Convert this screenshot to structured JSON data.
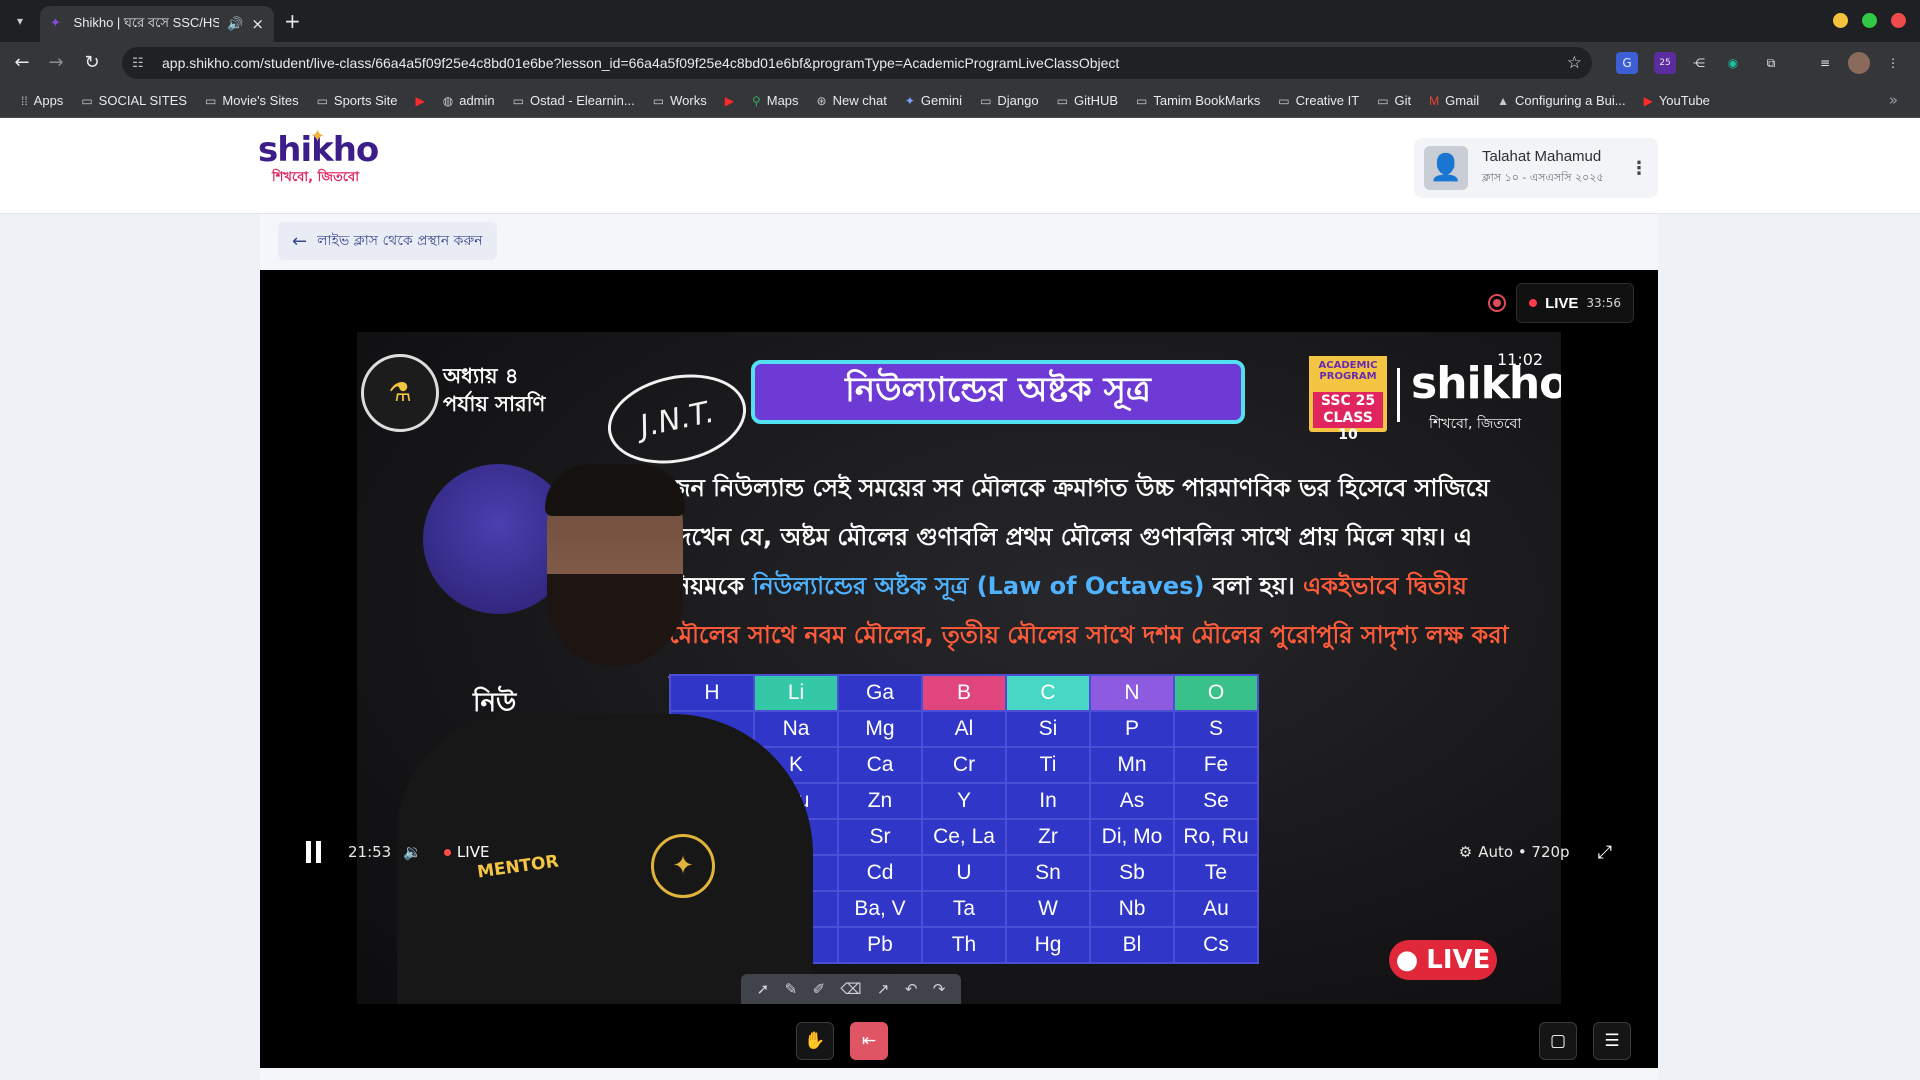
{
  "browser": {
    "tab": {
      "title": "Shikho | ঘরে বসে SSC/HSC"
    },
    "url": "app.shikho.com/student/live-class/66a4a5f09f25e4c8bd01e6be?lesson_id=66a4a5f09f25e4c8bd01e6bf&programType=AcademicProgramLiveClassObject",
    "extension_badge": "25",
    "bookmarks": [
      {
        "label": "Apps",
        "icon": "apps-grid-icon"
      },
      {
        "label": "SOCIAL SITES",
        "icon": "folder-icon"
      },
      {
        "label": "Movie's Sites",
        "icon": "folder-icon"
      },
      {
        "label": "Sports Site",
        "icon": "folder-icon"
      },
      {
        "label": "",
        "icon": "youtube-icon"
      },
      {
        "label": "admin",
        "icon": "globe-icon"
      },
      {
        "label": "Ostad - Elearnin...",
        "icon": "folder-icon"
      },
      {
        "label": "Works",
        "icon": "folder-icon"
      },
      {
        "label": "",
        "icon": "youtube-icon"
      },
      {
        "label": "Maps",
        "icon": "maps-pin-icon"
      },
      {
        "label": "New chat",
        "icon": "chatgpt-icon"
      },
      {
        "label": "Gemini",
        "icon": "gemini-icon"
      },
      {
        "label": "Django",
        "icon": "folder-icon"
      },
      {
        "label": "GitHUB",
        "icon": "folder-icon"
      },
      {
        "label": "Tamim BookMarks",
        "icon": "folder-icon"
      },
      {
        "label": "Creative IT",
        "icon": "folder-icon"
      },
      {
        "label": "Git",
        "icon": "folder-icon"
      },
      {
        "label": "Gmail",
        "icon": "gmail-icon"
      },
      {
        "label": "Configuring a Bui...",
        "icon": "triangle-icon"
      },
      {
        "label": "YouTube",
        "icon": "youtube-icon"
      }
    ]
  },
  "header": {
    "logo_word": "shikho",
    "logo_tagline": "শিখবো, জিতবো",
    "user": {
      "name": "Talahat Mahamud",
      "subtitle": "ক্লাস ১০ - এসএসসি ২০২৫"
    }
  },
  "back_button": {
    "label": "লাইভ ক্লাস থেকে প্রস্থান করুন"
  },
  "player": {
    "live_label": "LIVE",
    "live_elapsed": "33:56",
    "current_time": "21:53",
    "controls_live": "LIVE",
    "quality": "Auto • 720p"
  },
  "video_content": {
    "chapter": "অধ্যায় ৪",
    "chapter_sub": "পর্যায় সারণি",
    "handwriting": "J.N.T.",
    "title": "নিউল্যান্ডের অষ্টক সূত্র",
    "badge_top": "ACADEMIC PROGRAM",
    "badge_bottom": "SSC 25 CLASS 10",
    "watermark_word": "shikho",
    "watermark_tag": "শিখবো, জিতবো",
    "clock": "11:02",
    "para_1": "জন নিউল্যান্ড সেই সময়ের সব মৌলকে ক্রমাগত উচ্চ পারমাণবিক ভর হিসেবে সাজিয়ে দেখেন যে, অষ্টম মৌলের গুণাবলি প্রথম মৌলের গুণাবলির সাথে প্রায় মিলে যায়। এ নিয়মকে",
    "para_blue": "নিউল্যান্ডের অষ্টক সূত্র (Law of Octaves)",
    "para_2": " বলা হয়।",
    "para_orange": " একইভাবে দ্বিতীয় মৌলের সাথে নবম মৌলের, তৃতীয় মৌলের সাথে দশম মৌলের পুরোপুরি সাদৃশ্য লক্ষ করা যায়।",
    "side_word": "নিউ",
    "table_header": [
      "H",
      "Li",
      "Ga",
      "B",
      "C",
      "N",
      "O"
    ],
    "table_header_colors": [
      "#2f36c8",
      "#35c8a6",
      "#2f36c8",
      "#e0457e",
      "#48d7c4",
      "#8c5be0",
      "#38c28a"
    ],
    "table_rows": [
      [
        "",
        "Na",
        "Mg",
        "Al",
        "Si",
        "P",
        "S"
      ],
      [
        "",
        "K",
        "Ca",
        "Cr",
        "Ti",
        "Mn",
        "Fe"
      ],
      [
        "",
        "Cu",
        "Zn",
        "Y",
        "In",
        "As",
        "Se"
      ],
      [
        "",
        "b",
        "Sr",
        "Ce, La",
        "Zr",
        "Di, Mo",
        "Ro, Ru"
      ],
      [
        "",
        "",
        "Cd",
        "U",
        "Sn",
        "Sb",
        "Te"
      ],
      [
        "",
        "",
        "Ba, V",
        "Ta",
        "W",
        "Nb",
        "Au"
      ],
      [
        "",
        "",
        "Pb",
        "Th",
        "Hg",
        "Bl",
        "Cs"
      ]
    ],
    "teacher_shirt": "MENTOR",
    "live_stamp": "LIVE"
  }
}
